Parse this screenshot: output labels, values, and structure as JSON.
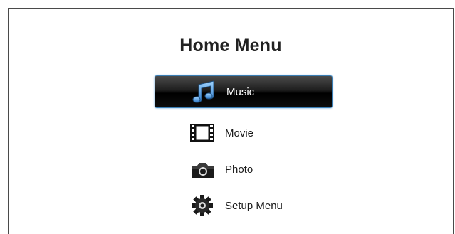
{
  "home_menu": {
    "title": "Home Menu",
    "items": [
      {
        "label": "Music",
        "icon": "music-notes-icon",
        "selected": true
      },
      {
        "label": "Movie",
        "icon": "film-strip-icon",
        "selected": false
      },
      {
        "label": "Photo",
        "icon": "camera-icon",
        "selected": false
      },
      {
        "label": "Setup Menu",
        "icon": "gear-icon",
        "selected": false
      }
    ]
  },
  "colors": {
    "selected_border": "#3b7fb5",
    "selected_background": "#000000",
    "selected_text": "#ffffff",
    "text": "#1a1a1a"
  }
}
